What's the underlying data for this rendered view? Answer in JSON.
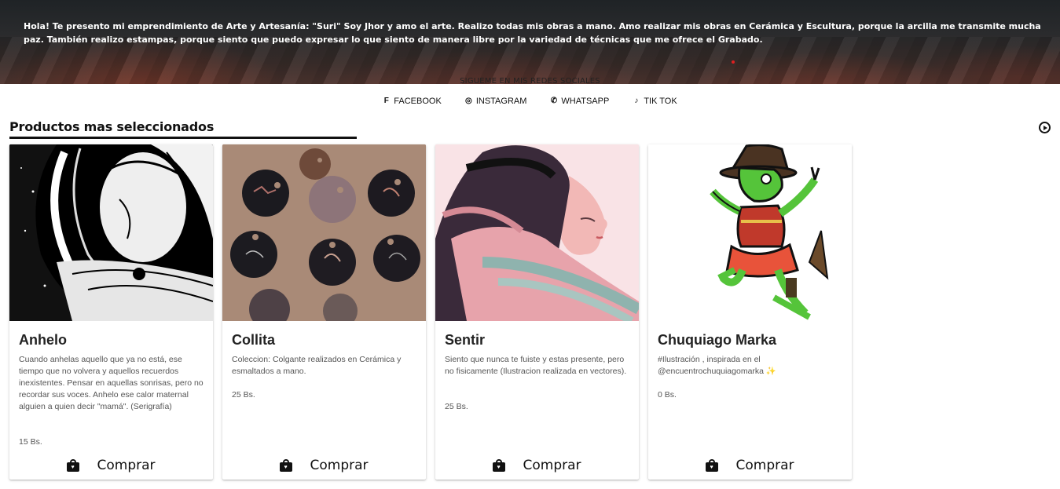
{
  "hero": {
    "intro": "Hola! Te presento mi emprendimiento de Arte y Artesanía: \"Suri\" Soy Jhor y amo el arte. Realizo todas mis obras a mano. Amo realizar mis obras en Cerámica y Escultura, porque la arcilla me transmite mucha paz. También realizo estampas, porque siento que puedo expresar lo que siento de manera libre por la variedad de técnicas que me ofrece el Grabado."
  },
  "social": {
    "heading": "SIGUEME EN MIS REDES SOCIALES",
    "links": [
      {
        "label": "FACEBOOK",
        "icon": "facebook-icon"
      },
      {
        "label": "INSTAGRAM",
        "icon": "instagram-icon"
      },
      {
        "label": "WHATSAPP",
        "icon": "whatsapp-icon"
      },
      {
        "label": "TIK TOK",
        "icon": "tiktok-icon"
      }
    ]
  },
  "products": {
    "title": "Productos mas seleccionados",
    "buy_label": "Comprar",
    "items": [
      {
        "title": "Anhelo",
        "description": "Cuando anhelas aquello que ya no está, ese tiempo que no volvera y aquellos recuerdos inexistentes. Pensar en aquellas sonrisas, pero no recordar sus voces. Anhelo ese calor maternal alguien a quien decir \"mamá\". (Serigrafía)",
        "price": "15 Bs."
      },
      {
        "title": "Collita",
        "description": "Coleccion: Colgante realizados en Cerámica y esmaltados a mano.",
        "price": "25 Bs."
      },
      {
        "title": "Sentir",
        "description": "Siento que nunca te fuiste y estas presente, pero no fisicamente (Ilustracion realizada en vectores).",
        "price": "25 Bs."
      },
      {
        "title": "Chuquiago Marka",
        "description": "#Ilustración , inspirada en el @encuentrochuquiagomarka ✨",
        "price": "0 Bs."
      }
    ]
  }
}
